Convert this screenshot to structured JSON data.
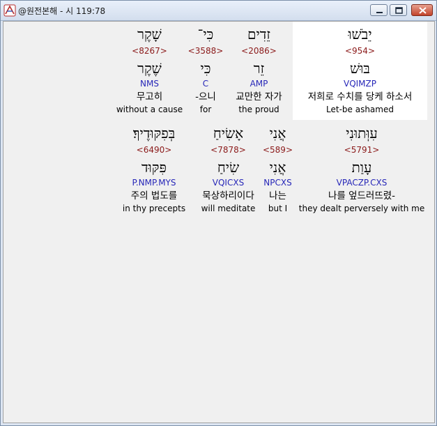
{
  "window": {
    "title": "@원전본해 - 시 119:78"
  },
  "rows": [
    {
      "words": [
        {
          "heb": "שָׁקֶר",
          "strong": "<8267>",
          "lemma": "שֶׁקֶר",
          "code": "NMS",
          "kor": "무고히",
          "eng": "without a cause"
        },
        {
          "heb": "כִּי־",
          "strong": "<3588>",
          "lemma": "כִּי",
          "code": "C",
          "kor": "-으니",
          "eng": "for"
        },
        {
          "heb": "זֵדִים",
          "strong": "<2086>",
          "lemma": "זֵר",
          "code": "AMP",
          "kor": "교만한 자가",
          "eng": "the proud"
        },
        {
          "heb": "יֵבֹשׁוּ",
          "strong": "<954>",
          "lemma": "בּוּשׁ",
          "code": "VQIMZP",
          "kor": "저희로 수치를 당케 하소서",
          "eng": "Let-be ashamed"
        }
      ]
    },
    {
      "words": [
        {
          "heb": "בְּפִקּוּדֶיךָ׃",
          "strong": "<6490>",
          "lemma": "פִּקּוּד",
          "code": "P.NMP.MYS",
          "kor": "주의 법도를",
          "eng": "in thy precepts"
        },
        {
          "heb": "אָשִׂיחַ",
          "strong": "<7878>",
          "lemma": "שִׂיחַ",
          "code": "VQICXS",
          "kor": "묵상하리이다",
          "eng": "will meditate"
        },
        {
          "heb": "אֲנִי",
          "strong": "<589>",
          "lemma": "אֲנִי",
          "code": "NPCXS",
          "kor": "나는",
          "eng": "but I"
        },
        {
          "heb": "עִוְּתוּנִי",
          "strong": "<5791>",
          "lemma": "עָוַת",
          "code": "VPACZP.CXS",
          "kor": "나를 엎드러뜨렸-",
          "eng": "they dealt perversely with me"
        }
      ]
    }
  ]
}
